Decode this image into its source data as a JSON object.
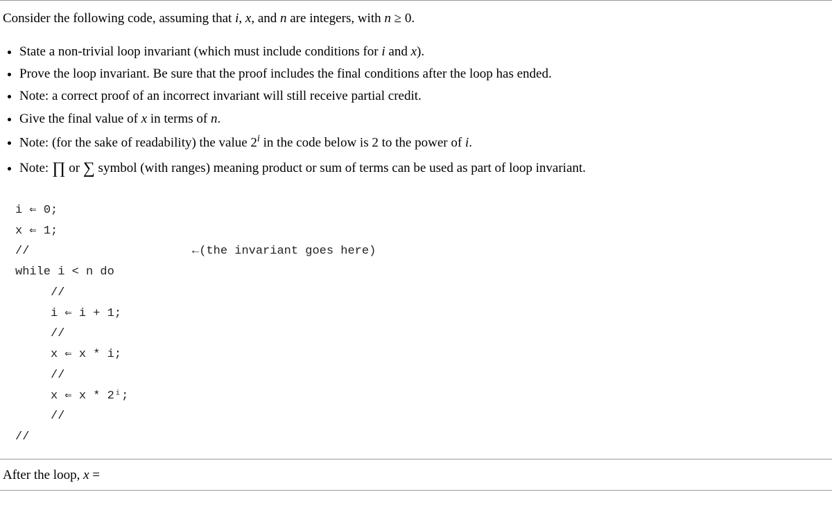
{
  "intro": {
    "prefix": "Consider the following code, assuming that ",
    "i": "i",
    "comma1": ", ",
    "x": "x",
    "comma2": ", and ",
    "n": "n",
    "suffix": " are integers, with ",
    "cond_n": "n",
    "geq": " ≥ ",
    "zero": "0",
    "period": "."
  },
  "tasks": {
    "t1_a": "State a non-trivial loop invariant (which must include conditions for ",
    "t1_i": "i",
    "t1_b": " and ",
    "t1_x": "x",
    "t1_c": ").",
    "t2": "Prove the loop invariant. Be sure that the proof includes the final conditions after the loop has ended.",
    "t3": "Note: a correct proof of an incorrect invariant will still receive partial credit.",
    "t4_a": "Give the final value of ",
    "t4_x": "x",
    "t4_b": " in terms of ",
    "t4_n": "n",
    "t4_c": ".",
    "t5_a": "Note: (for the sake of readability) the value ",
    "t5_base": "2",
    "t5_exp": "i",
    "t5_b": " in the code below is ",
    "t5_two": "2",
    "t5_c": " to the power of ",
    "t5_i": "i",
    "t5_d": ".",
    "t6_a": "Note: ",
    "t6_prod": "∏",
    "t6_or": " or ",
    "t6_sum": "∑",
    "t6_b": " symbol (with ranges) meaning product or sum of terms can be used as part of loop invariant."
  },
  "code": {
    "l1": "i ⇐ 0;",
    "l2": "x ⇐ 1;",
    "l3a": "//",
    "l3b": "                       ←(the invariant goes here)",
    "l4": "while i < n do",
    "l5": "     //",
    "l6": "     i ⇐ i + 1;",
    "l7": "     //",
    "l8": "     x ⇐ x * i;",
    "l9": "     //",
    "l10": "     x ⇐ x * 2ⁱ;",
    "l11": "     //",
    "l12": "//"
  },
  "after": {
    "text": "After the loop, ",
    "x": "x",
    "eq": " ="
  }
}
